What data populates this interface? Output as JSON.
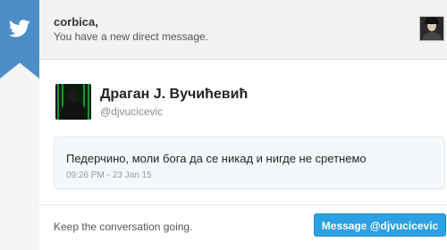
{
  "header": {
    "recipient": "corbica,",
    "subtitle": "You have a new direct message."
  },
  "icons": {
    "brand": "twitter-bird-icon",
    "ribbon_color": "#4d8ec9"
  },
  "sender": {
    "name": "Драган Ј. Вучићевић",
    "handle": "@djvucicevic"
  },
  "message": {
    "text": "Педерчино, моли бога да се никад и нигде не сретнемо",
    "timestamp": "09:26 PM - 23 Jan 15"
  },
  "footer": {
    "cta_text": "Keep the conversation going.",
    "button_label": "Message @djvucicevic",
    "button_color": "#2ba0e3"
  }
}
